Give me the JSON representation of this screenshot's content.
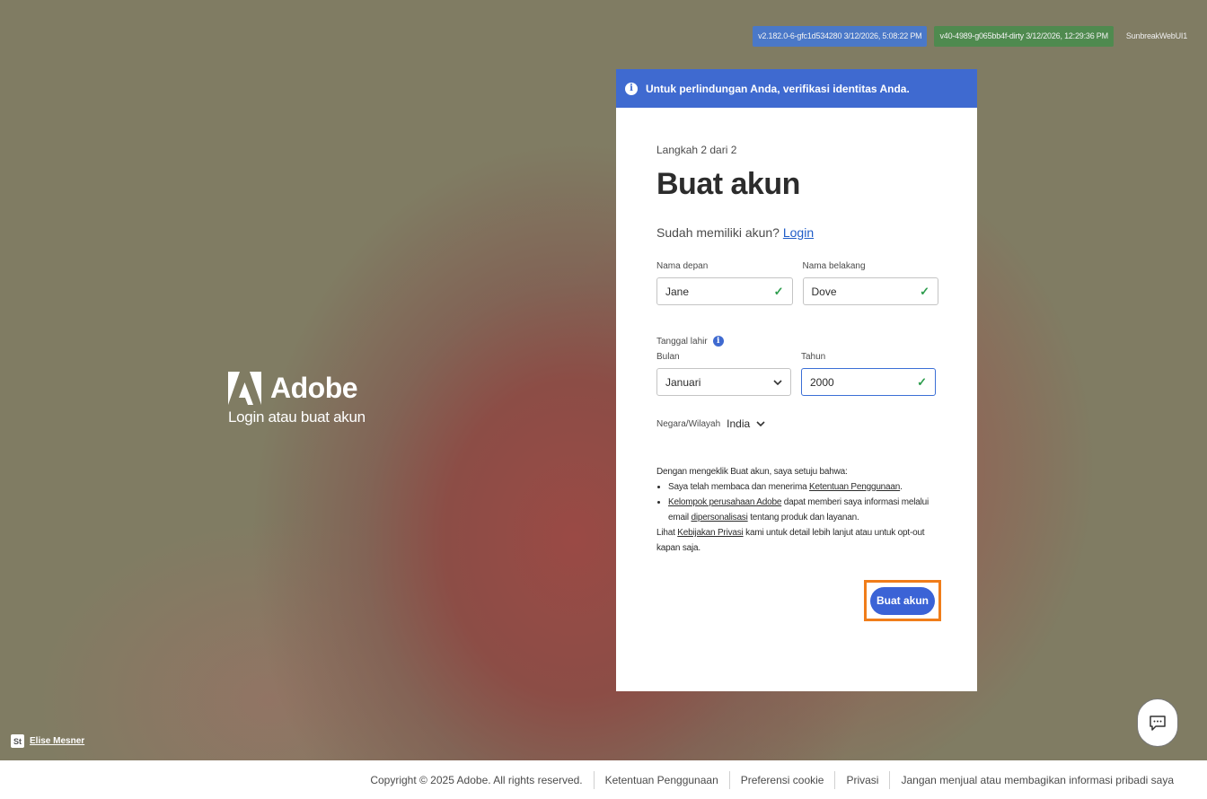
{
  "version_badges": [
    {
      "text": "v2.182.0-6-gfc1d534280 3/12/2026, 5:08:22 PM",
      "color": "#4a78c8"
    },
    {
      "text": "v40-4989-g065bb4f-dirty 3/12/2026, 12:29:36 PM",
      "color": "#4f8a4f"
    },
    {
      "text": "SunbreakWebUI1"
    }
  ],
  "brand": {
    "name": "Adobe",
    "subtitle": "Login atau buat akun"
  },
  "photo_credit": {
    "logo": "St",
    "name": "Elise Mesner"
  },
  "banner": {
    "text": "Untuk perlindungan Anda, verifikasi identitas Anda.",
    "icon": "info-icon",
    "color": "#3f6ad0"
  },
  "form": {
    "step": "Langkah 2 dari 2",
    "title": "Buat akun",
    "have_account": "Sudah memiliki akun?",
    "login_link": "Login",
    "first_name": {
      "label": "Nama depan",
      "value": "Jane"
    },
    "last_name": {
      "label": "Nama belakang",
      "value": "Dove"
    },
    "dob_label": "Tanggal lahir",
    "month": {
      "label": "Bulan",
      "value": "Januari"
    },
    "year": {
      "label": "Tahun",
      "value": "2000"
    },
    "country": {
      "label": "Negara/Wilayah",
      "value": "India"
    }
  },
  "legal": {
    "intro": "Dengan mengeklik Buat akun, saya setuju bahwa:",
    "b1_pre": "Saya telah membaca dan menerima ",
    "b1_link": "Ketentuan Penggunaan",
    "b1_post": ".",
    "b2_link1": "Kelompok perusahaan Adobe",
    "b2_mid": " dapat memberi saya informasi melalui email ",
    "b2_link2": "dipersonalisasi",
    "b2_post": " tentang produk dan layanan.",
    "p_pre": "Lihat ",
    "p_link": "Kebijakan Privasi",
    "p_post": " kami untuk detail lebih lanjut atau untuk opt-out kapan saja."
  },
  "submit_label": "Buat akun",
  "highlight_color": "#f07d1a",
  "footer": {
    "copyright": "Copyright © 2025 Adobe. All rights reserved.",
    "terms": "Ketentuan Penggunaan",
    "cookies": "Preferensi cookie",
    "privacy": "Privasi",
    "do_not_sell": "Jangan menjual atau membagikan informasi pribadi saya"
  }
}
